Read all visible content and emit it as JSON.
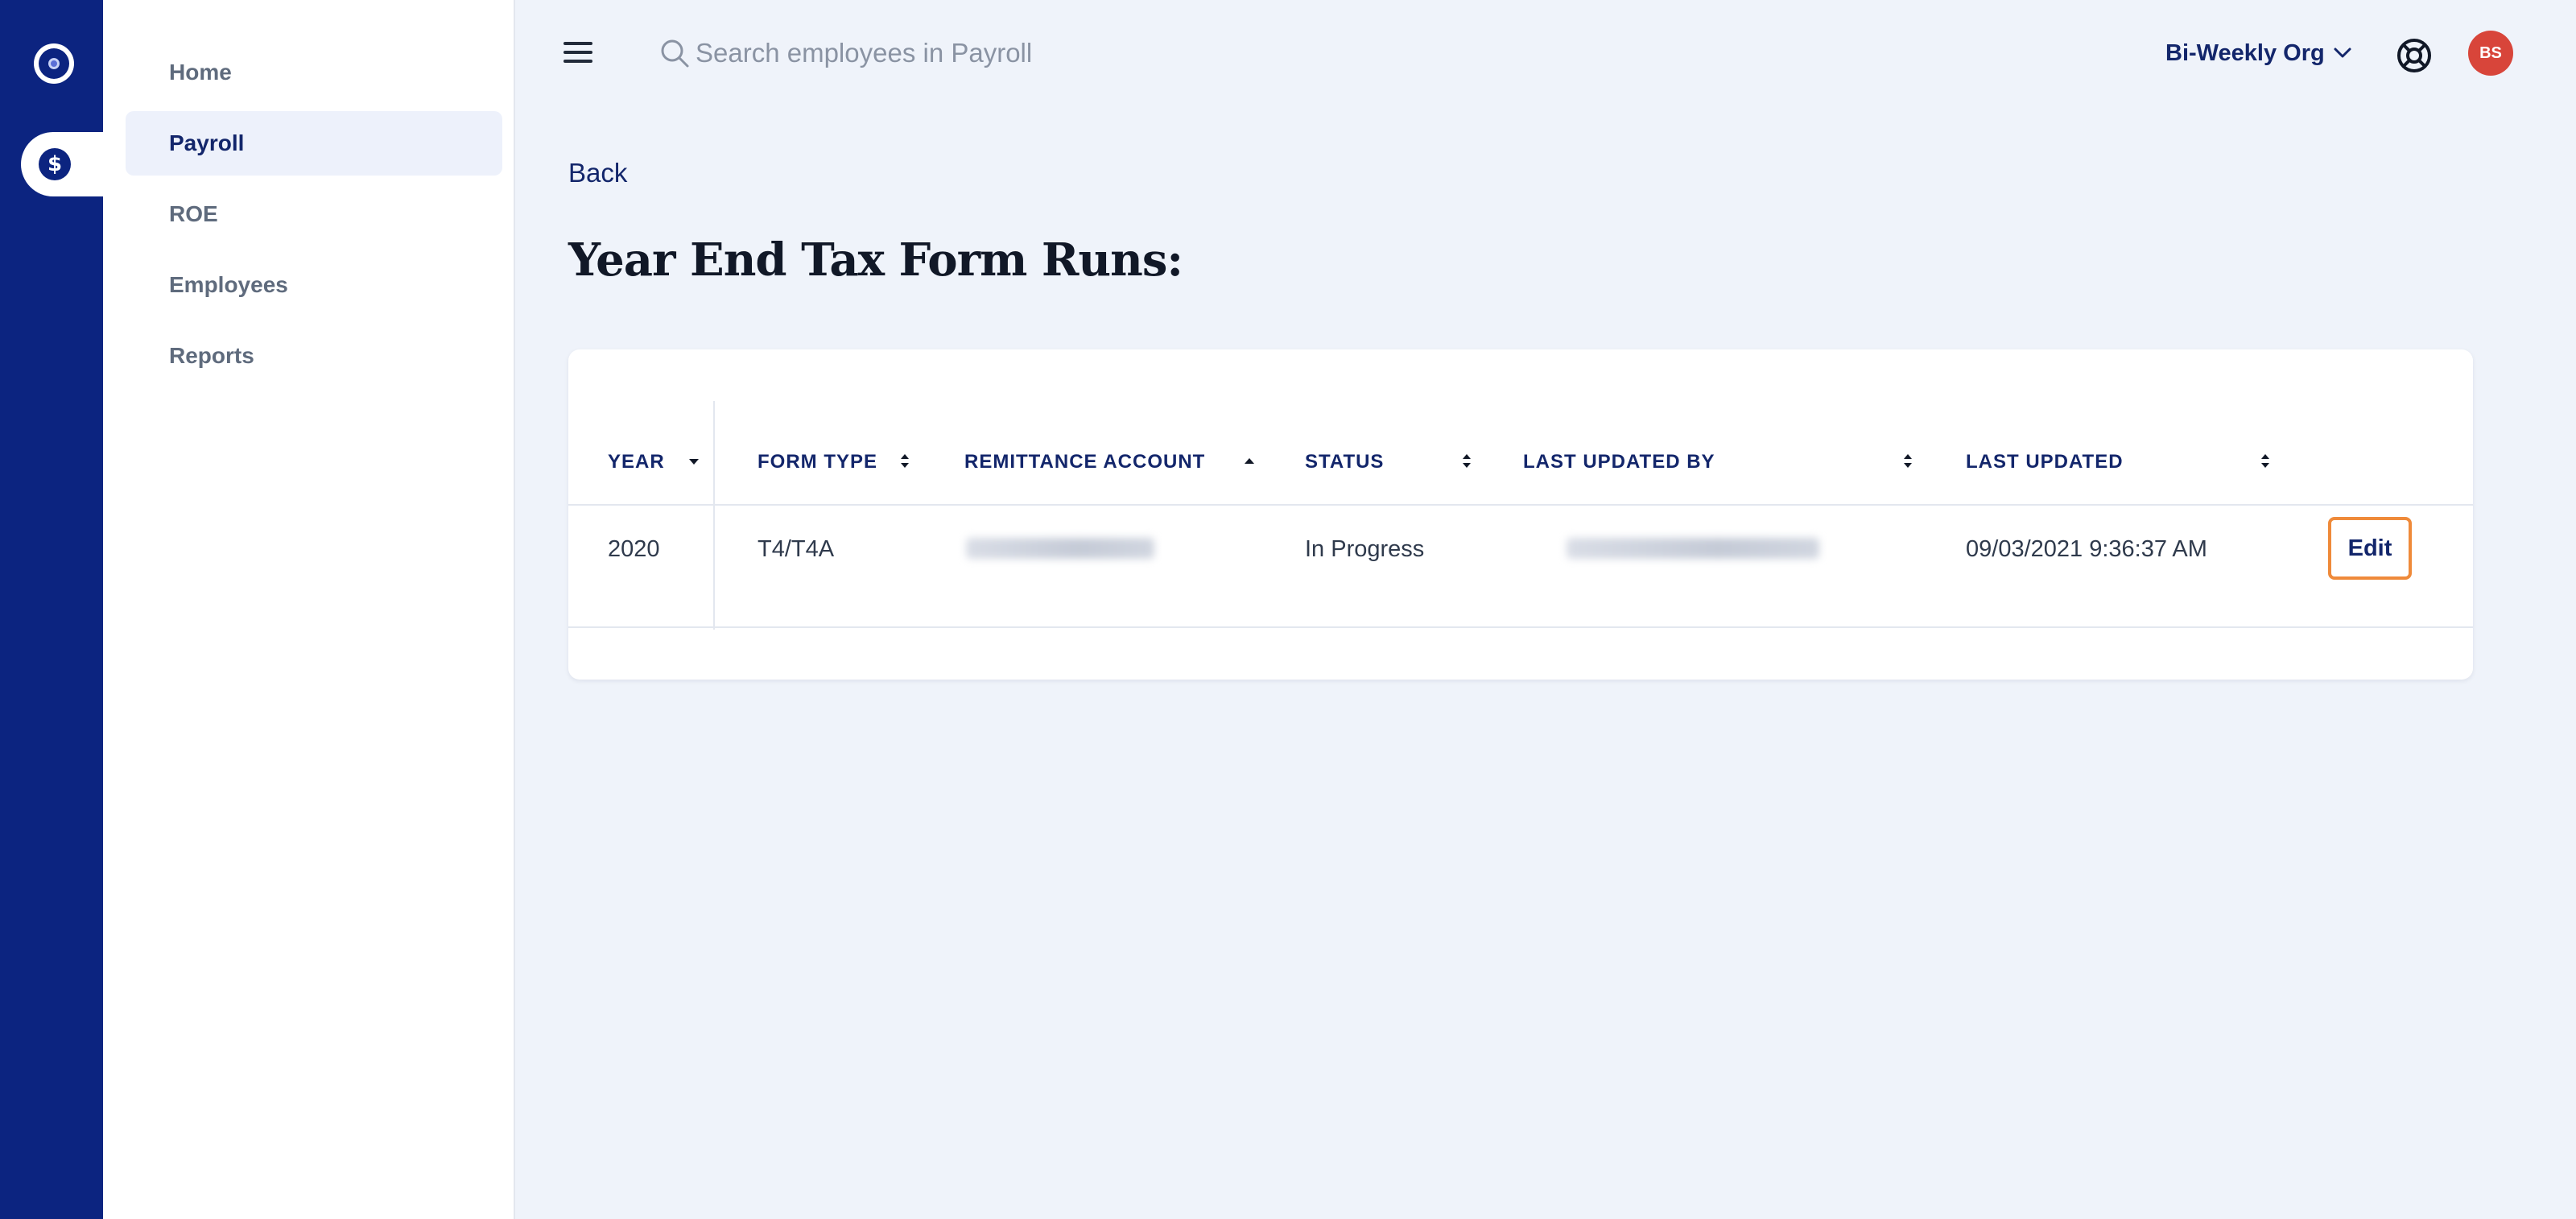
{
  "rail": {
    "logo_icon": "app-logo-icon",
    "active_icon": "dollar-coin-icon",
    "active_glyph": "$"
  },
  "sidebar": {
    "items": [
      {
        "label": "Home",
        "active": false
      },
      {
        "label": "Payroll",
        "active": true
      },
      {
        "label": "ROE",
        "active": false
      },
      {
        "label": "Employees",
        "active": false
      },
      {
        "label": "Reports",
        "active": false
      }
    ]
  },
  "topbar": {
    "menu_icon": "hamburger-icon",
    "search": {
      "placeholder": "Search employees in Payroll",
      "value": ""
    },
    "org": {
      "label": "Bi-Weekly Org",
      "icon": "chevron-down-icon"
    },
    "help_icon": "lifebuoy-icon",
    "avatar_initials": "BS"
  },
  "main": {
    "back_label": "Back",
    "title": "Year End Tax Form Runs:"
  },
  "table": {
    "columns": [
      {
        "label": "Year",
        "sort": "desc"
      },
      {
        "label": "Form Type",
        "sort": "none"
      },
      {
        "label": "Remittance Account",
        "sort": "asc"
      },
      {
        "label": "Status",
        "sort": "none"
      },
      {
        "label": "Last Updated By",
        "sort": "none"
      },
      {
        "label": "Last Updated",
        "sort": "none"
      }
    ],
    "rows": [
      {
        "year": "2020",
        "form_type": "T4/T4A",
        "status": "In Progress",
        "last_updated": "09/03/2021 9:36:37 AM",
        "action_label": "Edit"
      }
    ]
  },
  "colors": {
    "rail": "#0c2480",
    "brand_text": "#13266b",
    "page_bg": "#eff3fa",
    "highlight": "#ef8a3a",
    "avatar": "#d8453a"
  }
}
